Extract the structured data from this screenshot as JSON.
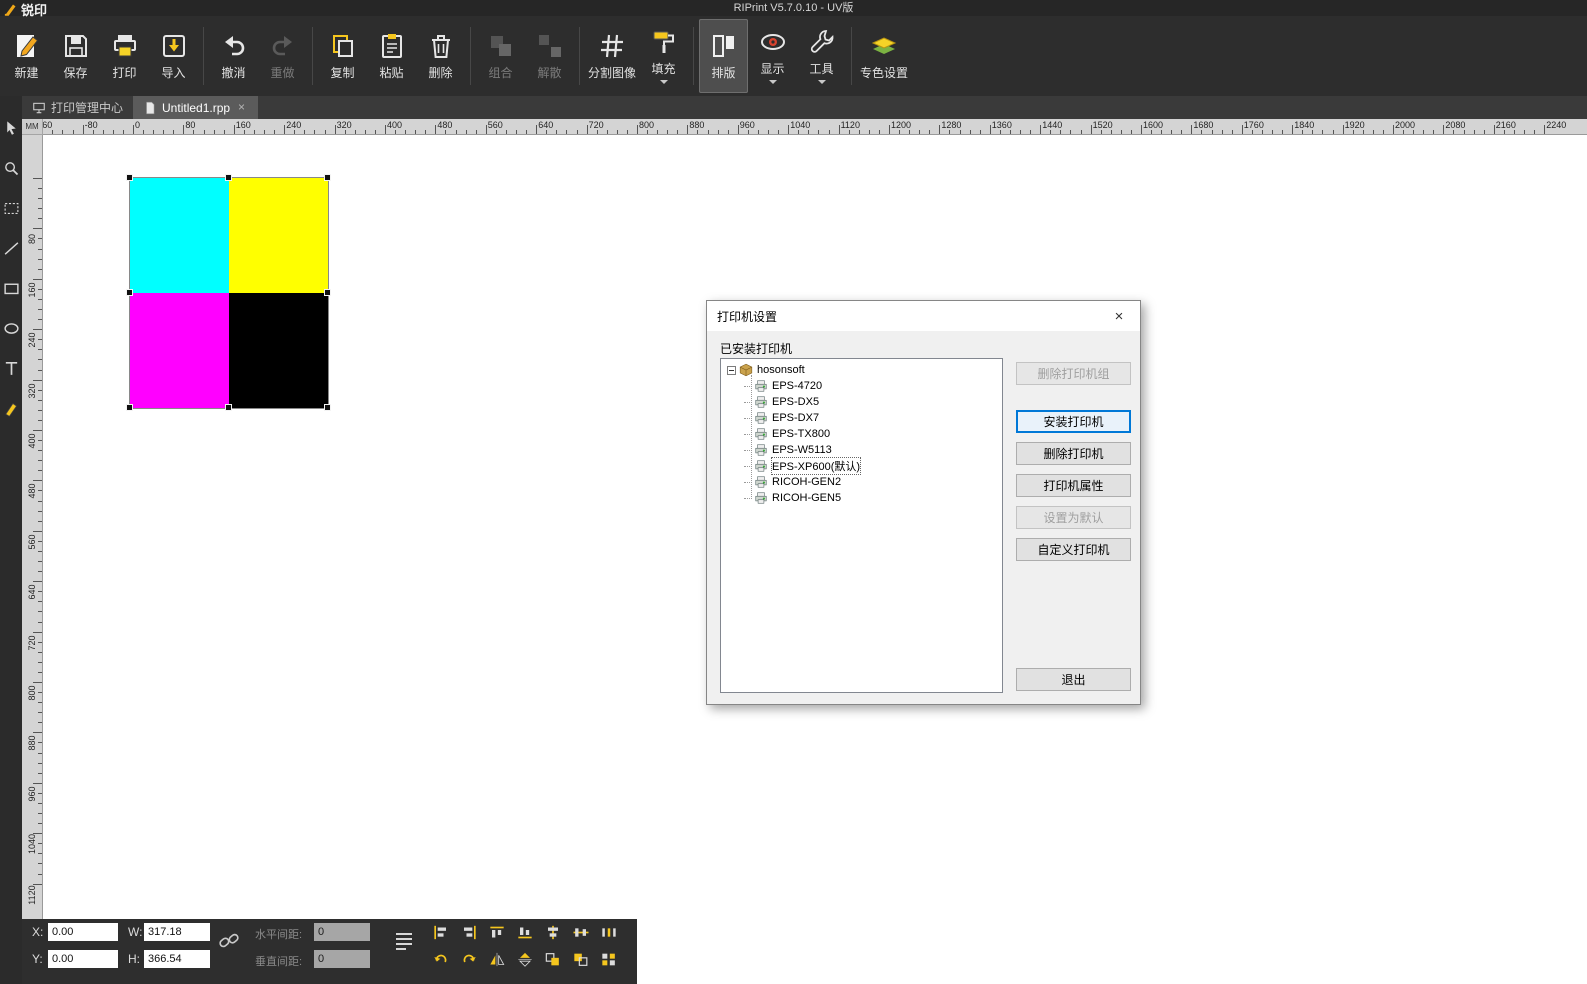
{
  "titlebar": {
    "logo": "锐印",
    "title": "RIPrint V5.7.0.10 - UV版"
  },
  "toolbar": {
    "groups": [
      [
        {
          "label": "新建",
          "icon": "new-icon"
        },
        {
          "label": "保存",
          "icon": "save-icon"
        },
        {
          "label": "打印",
          "icon": "print-icon"
        },
        {
          "label": "导入",
          "icon": "import-icon"
        }
      ],
      [
        {
          "label": "撤消",
          "icon": "undo-icon"
        },
        {
          "label": "重做",
          "icon": "redo-icon",
          "state": "disabled"
        }
      ],
      [
        {
          "label": "复制",
          "icon": "copy-icon"
        },
        {
          "label": "粘贴",
          "icon": "paste-icon"
        },
        {
          "label": "删除",
          "icon": "delete-icon"
        }
      ],
      [
        {
          "label": "组合",
          "icon": "group-icon",
          "state": "disabled"
        },
        {
          "label": "解散",
          "icon": "ungroup-icon",
          "state": "disabled"
        }
      ],
      [
        {
          "label": "分割图像",
          "icon": "split-image-icon"
        },
        {
          "label": "填充",
          "icon": "fill-icon",
          "dropdown": true
        }
      ],
      [
        {
          "label": "排版",
          "icon": "layout-icon",
          "state": "active"
        },
        {
          "label": "显示",
          "icon": "display-icon",
          "dropdown": true
        },
        {
          "label": "工具",
          "icon": "tools-icon",
          "dropdown": true
        }
      ],
      [
        {
          "label": "专色设置",
          "icon": "spot-color-icon"
        }
      ]
    ]
  },
  "tabs": [
    {
      "label": "打印管理中心",
      "active": false
    },
    {
      "label": "Untitled1.rpp",
      "active": true,
      "closable": true
    }
  ],
  "left_toolbar": {
    "tools": [
      {
        "name": "select-tool"
      },
      {
        "name": "zoom-tool"
      },
      {
        "name": "marquee-tool"
      },
      {
        "name": "line-tool"
      },
      {
        "name": "rect-tool"
      },
      {
        "name": "ellipse-tool"
      },
      {
        "name": "text-tool"
      },
      {
        "name": "pen-tool"
      }
    ]
  },
  "rulers": {
    "unit": "MM",
    "h_min": -160,
    "h_max": 2240,
    "v_min": 0,
    "v_max": 1120,
    "step": 80
  },
  "canvas": {
    "tiles": [
      "#00FFFF",
      "#FFFF00",
      "#FF00FF",
      "#000000"
    ]
  },
  "dialog": {
    "title": "打印机设置",
    "installed_label": "已安装打印机",
    "tree_root": "hosonsoft",
    "printers": [
      "EPS-4720",
      "EPS-DX5",
      "EPS-DX7",
      "EPS-TX800",
      "EPS-W5113",
      "EPS-XP600(默认)",
      "RICOH-GEN2",
      "RICOH-GEN5"
    ],
    "selected_printer": "EPS-XP600(默认)",
    "side_buttons": [
      {
        "label": "删除打印机组",
        "state": "disabled"
      },
      {
        "label": "安装打印机",
        "state": "default"
      },
      {
        "label": "删除打印机",
        "state": "normal"
      },
      {
        "label": "打印机属性",
        "state": "normal"
      },
      {
        "label": "设置为默认",
        "state": "disabled"
      },
      {
        "label": "自定义打印机",
        "state": "normal"
      }
    ],
    "exit_button": "退出"
  },
  "statusbar": {
    "x_label": "X:",
    "x_value": "0.00",
    "y_label": "Y:",
    "y_value": "0.00",
    "w_label": "W:",
    "w_value": "317.18",
    "h_label": "H:",
    "h_value": "366.54",
    "h_spacing_label": "水平间距:",
    "h_spacing_value": "0",
    "v_spacing_label": "垂直间距:",
    "v_spacing_value": "0",
    "top_buttons": [
      "align-left",
      "align-right",
      "align-top",
      "align-bottom",
      "align-center-h",
      "align-center-v",
      "distribute"
    ],
    "bottom_buttons": [
      "rotate-left",
      "rotate-right",
      "flip-horizontal",
      "flip-vertical",
      "duplicate-offset",
      "duplicate-step",
      "array-copy"
    ]
  }
}
